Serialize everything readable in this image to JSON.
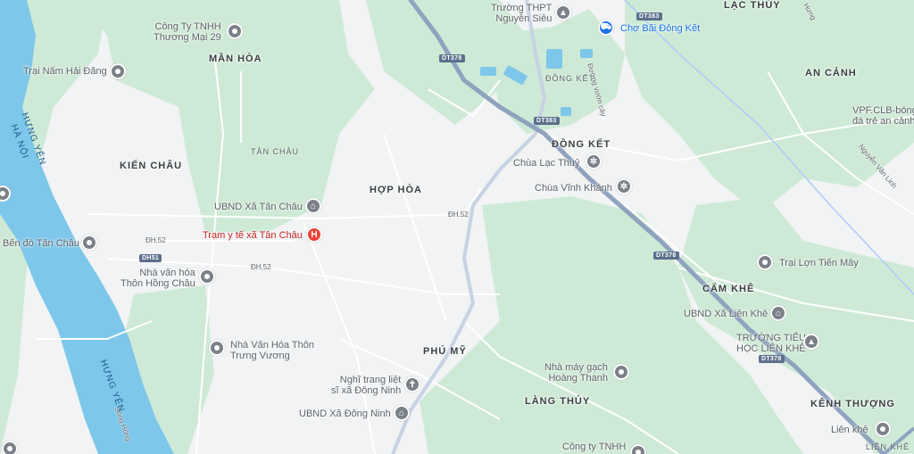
{
  "areas": {
    "man_hoa": "MẦN HÒA",
    "kien_chau": "KIẾN CHÂU",
    "tan_chau": "TÂN CHÂU",
    "hop_hoa": "HỢP HÒA",
    "phu_my": "PHÚ MỸ",
    "lang_thuy": "LÀNG THỦY",
    "lac_thuy": "LẠC THỦY",
    "an_canh": "AN CẢNH",
    "dong_ket_upper": "ĐỒNG KẾT",
    "dong_ket_small": "ĐỒNG KẾT",
    "cam_khe": "CẨM KHÊ",
    "kenh_thuong": "KÊNH THƯỢNG",
    "lien_khe": "LIÊN KHÊ"
  },
  "pois": {
    "cong_ty_29_l1": "Công Ty TNHH",
    "cong_ty_29_l2": "Thương Mại 29",
    "trai_nam": "Trại Nấm Hải Đăng",
    "ben_do": "Bến đò Tân Châu",
    "ubnd_tan_chau": "UBND Xã Tân Châu",
    "tram_y_te": "Trạm y tế xã Tân Châu",
    "nvh_hong_chau_l1": "Nhà văn hóa",
    "nvh_hong_chau_l2": "Thôn Hồng Châu",
    "nvh_trung_vuong_l1": "Nhà Văn Hóa Thôn",
    "nvh_trung_vuong_l2": "Trưng Vương",
    "nghia_trang_l1": "Nghĩ trang liệt",
    "nghia_trang_l2": "sĩ xã Đông Ninh",
    "ubnd_dong_ninh": "UBND Xã Đông Ninh",
    "truong_thpt_l1": "Trường THPT",
    "truong_thpt_l2": "Nguyễn Siêu",
    "cho_bai": "Chợ Bãi Đông Kết",
    "chua_lac_thuy": "Chùa Lạc Thuỷ",
    "chua_vinh_khanh": "Chùa Vĩnh Khánh",
    "nha_may_l1": "Nhà máy gạch",
    "nha_may_l2": "Hoàng Thanh",
    "cong_ty_bottom": "Công ty TNHH",
    "trai_lon": "Trại Lợn Tiến Mây",
    "ubnd_lien_khe": "UBND Xã Liên Khê",
    "truong_tieu_l1": "TRƯỜNG TIỂU",
    "truong_tieu_l2": "HỌC LIÊN KHÊ",
    "lien_khe_poi": "Liên khê",
    "vpf_l1": "VPF.CLB-bóng",
    "vpf_l2": "đá trẻ an cảnh"
  },
  "roads": {
    "dh52_a": "ĐH.52",
    "dh52_b": "ĐH.52",
    "dh52_c": "ĐH.52",
    "duong_vuon_cay": "Đường vườn cây",
    "nguyen_van_linh": "Nguyễn Văn Linh",
    "hung_road": "Hưng",
    "song_hong": "Sông Hồng"
  },
  "shields": {
    "dt378_top": "DT378",
    "dt383_top": "DT383",
    "dt383_mid": "DT383",
    "dt378_mid": "DT378",
    "dt378_low": "DT378",
    "dh51": "DH51"
  },
  "river_labels": {
    "hung_yen_top_l1": "HƯNG YÊN",
    "hung_yen_top_l2": "HÀ NỘI",
    "hung_yen_bottom": "HƯNG YÊN"
  },
  "colors": {
    "land": "#f1f3f4",
    "green": "#ceead6",
    "water": "#7dc7ea",
    "main_road": "#8fa3bf",
    "minor_road": "#ffffff",
    "poi_pin": "#7b8189",
    "hospital_pin": "#ea4335",
    "shop_pin": "#1a73e8"
  }
}
